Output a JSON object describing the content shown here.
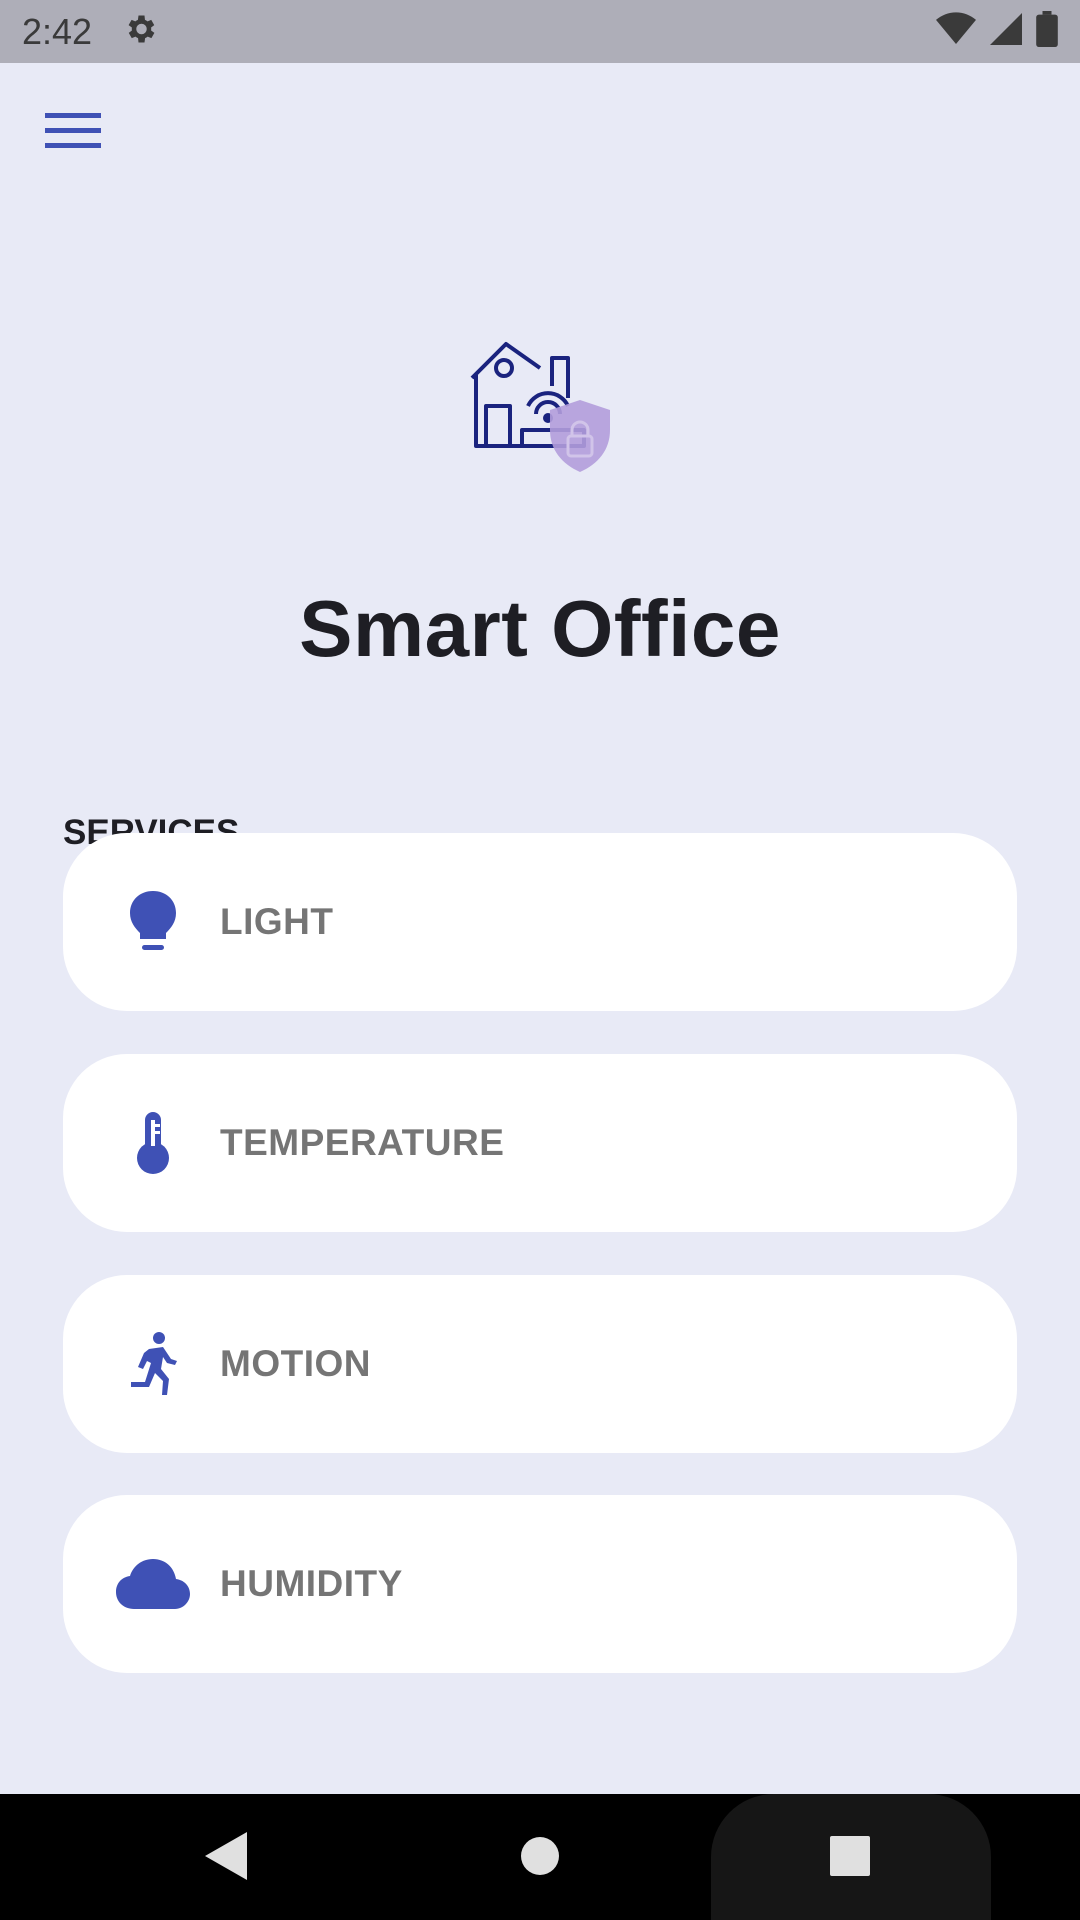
{
  "status_bar": {
    "time": "2:42",
    "icons": [
      "gear-icon",
      "wifi-icon",
      "signal-icon",
      "battery-icon"
    ]
  },
  "app": {
    "title": "Smart Office",
    "accent_color": "#3f51b5",
    "shield_color": "#b39ddb",
    "menu_icon": "hamburger-menu-icon",
    "hero_icon": "smart-home-shield-icon"
  },
  "services": {
    "section_label": "SERVICES",
    "items": [
      {
        "label": "LIGHT",
        "icon": "lightbulb-icon"
      },
      {
        "label": "TEMPERATURE",
        "icon": "thermometer-icon"
      },
      {
        "label": "MOTION",
        "icon": "running-person-icon"
      },
      {
        "label": "HUMIDITY",
        "icon": "cloud-icon"
      }
    ]
  },
  "nav_bar": {
    "buttons": [
      "back-icon",
      "home-icon",
      "recents-icon"
    ]
  }
}
